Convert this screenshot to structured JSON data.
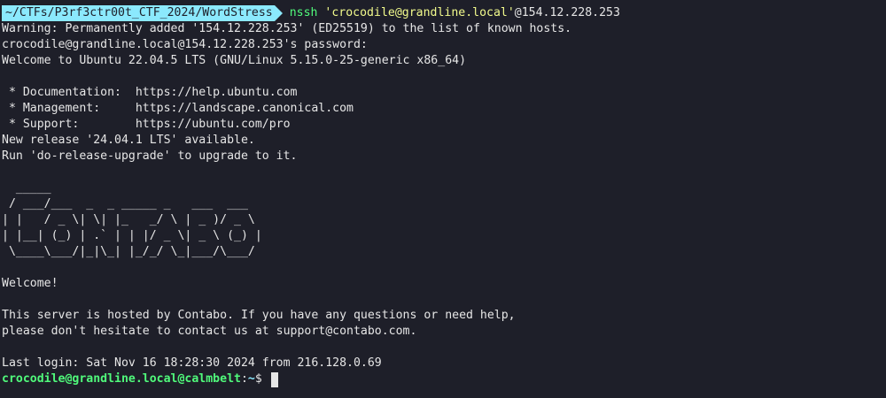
{
  "header": {
    "path": "~/CTFs/P3rf3ctr00t_CTF_2024/WordStress",
    "command": "nssh",
    "target_quoted": "'crocodile@grandline.local'",
    "target_host": "@154.12.228.253"
  },
  "output": {
    "warning": "Warning: Permanently added '154.12.228.253' (ED25519) to the list of known hosts.",
    "password_prompt": "crocodile@grandline.local@154.12.228.253's password:",
    "welcome_ubuntu": "Welcome to Ubuntu 22.04.5 LTS (GNU/Linux 5.15.0-25-generic x86_64)",
    "doc_line": " * Documentation:  https://help.ubuntu.com",
    "mgmt_line": " * Management:     https://landscape.canonical.com",
    "support_line": " * Support:        https://ubuntu.com/pro",
    "release_line": "New release '24.04.1 LTS' available.",
    "upgrade_line": "Run 'do-release-upgrade' to upgrade to it.",
    "ascii_banner": "  _____\n / ___/___  _  _ _____ _   ___  ___\n| |   / _ \\| \\| |_   _/ \\ | _ )/ _ \\\n| |__| (_) | .` | | |/ _ \\| _ \\ (_) |\n \\____\\___/|_|\\_| |_/_/ \\_|___/\\___/",
    "welcome": "Welcome!",
    "contabo_1": "This server is hosted by Contabo. If you have any questions or need help,",
    "contabo_2": "please don't hesitate to contact us at support@contabo.com.",
    "last_login": "Last login: Sat Nov 16 18:28:30 2024 from 216.128.0.69"
  },
  "prompt": {
    "user_host": "crocodile@grandline.local@calmbelt",
    "separator": ":",
    "cwd": "~",
    "symbol": "$ "
  },
  "colors": {
    "background": "#1e1f29",
    "foreground": "#e6e6e6",
    "path_bg": "#8be9fd",
    "command": "#50fa7b",
    "string": "#f1fa8c"
  }
}
